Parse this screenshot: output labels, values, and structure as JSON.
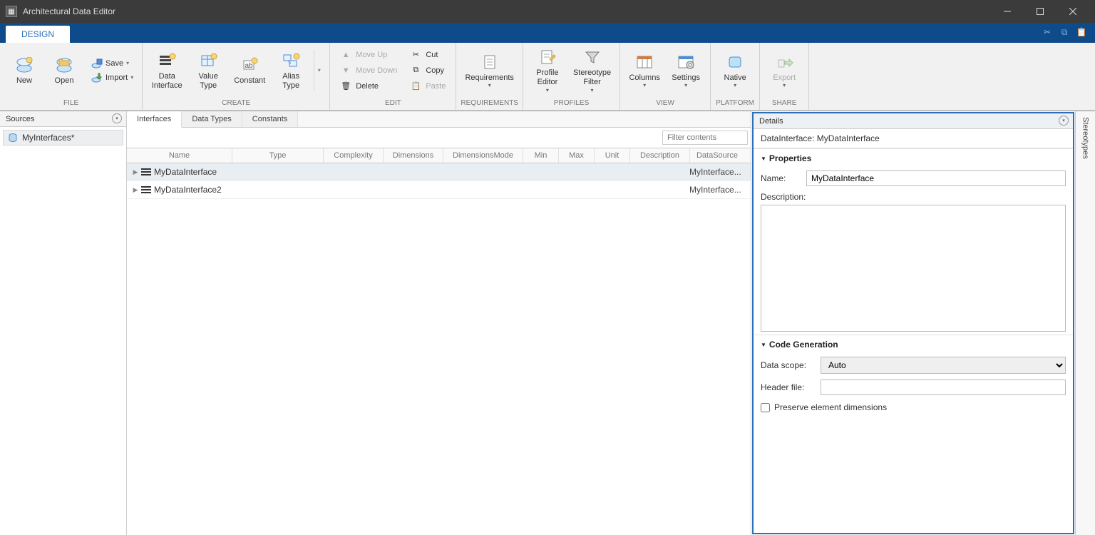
{
  "window": {
    "title": "Architectural Data Editor"
  },
  "ribbon": {
    "tab": "DESIGN",
    "groups": {
      "file": {
        "label": "FILE",
        "items": {
          "new": "New",
          "open": "Open",
          "save": "Save",
          "import": "Import"
        }
      },
      "create": {
        "label": "CREATE",
        "items": {
          "data_interface": "Data\nInterface",
          "value_type": "Value\nType",
          "constant": "Constant",
          "alias_type": "Alias\nType"
        }
      },
      "edit": {
        "label": "EDIT",
        "items": {
          "move_up": "Move Up",
          "move_down": "Move Down",
          "delete": "Delete",
          "cut": "Cut",
          "copy": "Copy",
          "paste": "Paste"
        }
      },
      "requirements": {
        "label": "REQUIREMENTS",
        "items": {
          "requirements": "Requirements"
        }
      },
      "profiles": {
        "label": "PROFILES",
        "items": {
          "profile_editor": "Profile\nEditor",
          "stereotype_filter": "Stereotype\nFilter"
        }
      },
      "view": {
        "label": "VIEW",
        "items": {
          "columns": "Columns",
          "settings": "Settings"
        }
      },
      "platform": {
        "label": "PLATFORM",
        "items": {
          "native": "Native"
        }
      },
      "share": {
        "label": "SHARE",
        "items": {
          "export": "Export"
        }
      }
    }
  },
  "sources": {
    "title": "Sources",
    "items": [
      "MyInterfaces*"
    ]
  },
  "center": {
    "tabs": [
      "Interfaces",
      "Data Types",
      "Constants"
    ],
    "active_tab": 0,
    "filter_placeholder": "Filter contents",
    "columns": [
      "Name",
      "Type",
      "Complexity",
      "Dimensions",
      "DimensionsMode",
      "Min",
      "Max",
      "Unit",
      "Description",
      "DataSource"
    ],
    "rows": [
      {
        "name": "MyDataInterface",
        "datasource": "MyInterface...",
        "selected": true
      },
      {
        "name": "MyDataInterface2",
        "datasource": "MyInterface...",
        "selected": false
      }
    ]
  },
  "details": {
    "title": "Details",
    "breadcrumb": "DataInterface: MyDataInterface",
    "sections": {
      "properties": {
        "title": "Properties",
        "name_label": "Name:",
        "name_value": "MyDataInterface",
        "description_label": "Description:",
        "description_value": ""
      },
      "codegen": {
        "title": "Code Generation",
        "scope_label": "Data scope:",
        "scope_value": "Auto",
        "header_label": "Header file:",
        "header_value": "",
        "preserve_label": "Preserve element dimensions",
        "preserve_checked": false
      }
    }
  },
  "right_tab": {
    "label": "Stereotypes"
  }
}
